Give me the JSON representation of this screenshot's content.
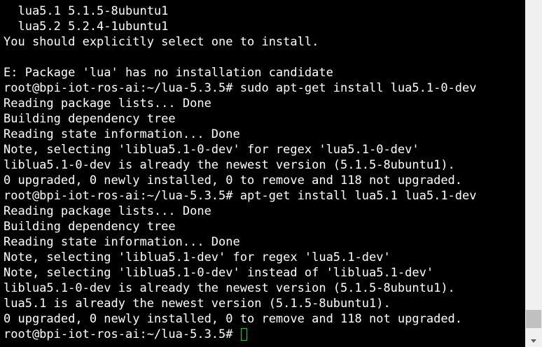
{
  "terminal": {
    "lines": [
      "  lua5.1 5.1.5-8ubuntu1",
      "  lua5.2 5.2.4-1ubuntu1",
      "You should explicitly select one to install.",
      "",
      "E: Package 'lua' has no installation candidate",
      "root@bpi-iot-ros-ai:~/lua-5.3.5# sudo apt-get install lua5.1-0-dev",
      "Reading package lists... Done",
      "Building dependency tree",
      "Reading state information... Done",
      "Note, selecting 'liblua5.1-0-dev' for regex 'lua5.1-0-dev'",
      "liblua5.1-0-dev is already the newest version (5.1.5-8ubuntu1).",
      "0 upgraded, 0 newly installed, 0 to remove and 118 not upgraded.",
      "root@bpi-iot-ros-ai:~/lua-5.3.5# apt-get install lua5.1 lua5.1-dev",
      "Reading package lists... Done",
      "Building dependency tree",
      "Reading state information... Done",
      "Note, selecting 'liblua5.1-dev' for regex 'lua5.1-dev'",
      "Note, selecting 'liblua5.1-0-dev' instead of 'liblua5.1-dev'",
      "liblua5.1-0-dev is already the newest version (5.1.5-8ubuntu1).",
      "lua5.1 is already the newest version (5.1.5-8ubuntu1).",
      "0 upgraded, 0 newly installed, 0 to remove and 118 not upgraded."
    ],
    "prompt": "root@bpi-iot-ros-ai:~/lua-5.3.5# ",
    "colors": {
      "background": "#000000",
      "foreground": "#ffffff",
      "cursor": "#00e000"
    }
  },
  "scrollbar": {
    "position": 1.0
  }
}
